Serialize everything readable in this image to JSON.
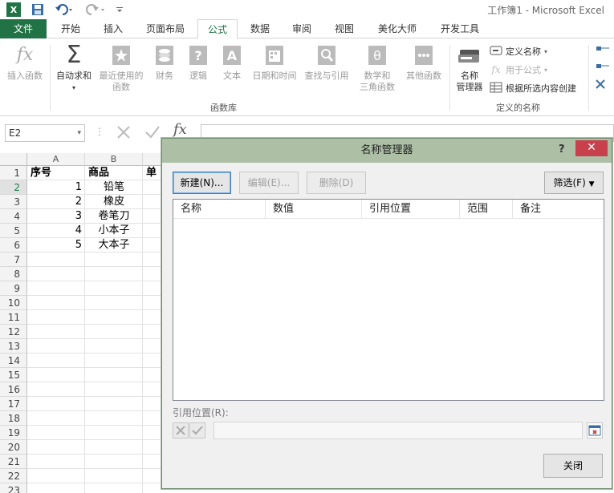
{
  "window": {
    "title": "工作簿1 - Microsoft Excel"
  },
  "tabs": {
    "file": "文件",
    "items": [
      "开始",
      "插入",
      "页面布局",
      "公式",
      "数据",
      "审阅",
      "视图",
      "美化大师",
      "开发工具"
    ],
    "active": "公式"
  },
  "ribbon": {
    "insert_function": "插入函数",
    "autosum": "自动求和",
    "recent_1": "最近使用的",
    "recent_2": "函数",
    "financial": "财务",
    "logical": "逻辑",
    "text": "文本",
    "datetime": "日期和时间",
    "lookup": "查找与引用",
    "math_1": "数学和",
    "math_2": "三角函数",
    "other": "其他函数",
    "group_library": "函数库",
    "name_manager_1": "名称",
    "name_manager_2": "管理器",
    "define_name": "定义名称",
    "use_in_formula": "用于公式",
    "create_from_selection": "根据所选内容创建",
    "group_defined_names": "定义的名称"
  },
  "formula_bar": {
    "namebox": "E2",
    "fx": "fx"
  },
  "sheet": {
    "columns": [
      "A",
      "B"
    ],
    "rows": [
      "1",
      "2",
      "3",
      "4",
      "5",
      "6",
      "7",
      "8",
      "9",
      "10",
      "11",
      "12",
      "13",
      "14",
      "15",
      "16",
      "17",
      "18",
      "19",
      "20",
      "21",
      "22",
      "23"
    ],
    "header_a": "序号",
    "header_b": "商品",
    "header_c": "单",
    "data": [
      {
        "no": "1",
        "item": "铅笔"
      },
      {
        "no": "2",
        "item": "橡皮"
      },
      {
        "no": "3",
        "item": "卷笔刀"
      },
      {
        "no": "4",
        "item": "小本子"
      },
      {
        "no": "5",
        "item": "大本子"
      }
    ]
  },
  "dialog": {
    "title": "名称管理器",
    "help": "?",
    "new": "新建(N)...",
    "edit": "编辑(E)...",
    "delete": "删除(D)",
    "filter": "筛选(F)",
    "columns": [
      "名称",
      "数值",
      "引用位置",
      "范围",
      "备注"
    ],
    "ref_label": "引用位置(R):",
    "close": "关闭"
  },
  "colors": {
    "excel_green": "#217346",
    "dialog_title": "#adc0a6",
    "close_red": "#c7404c"
  }
}
